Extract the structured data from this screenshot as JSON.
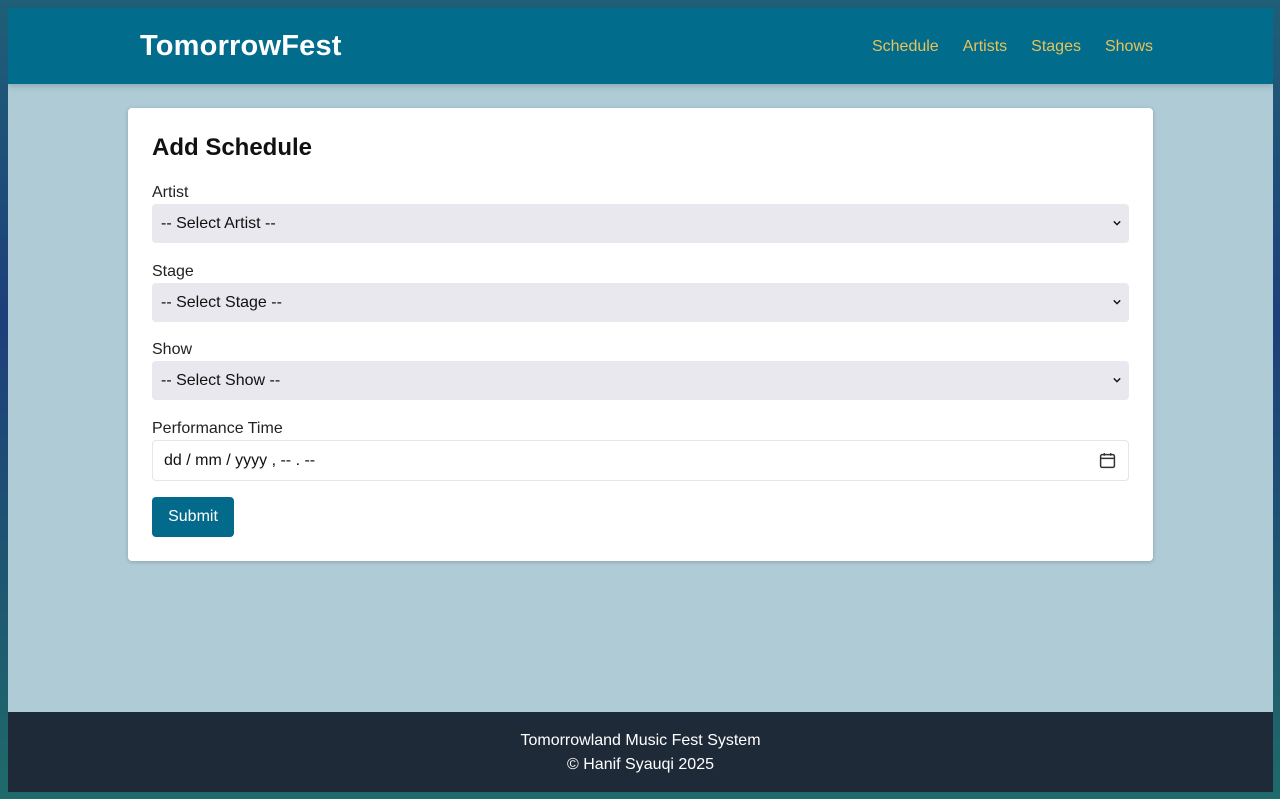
{
  "navbar": {
    "brand": "TomorrowFest",
    "links": [
      "Schedule",
      "Artists",
      "Stages",
      "Shows"
    ]
  },
  "form": {
    "title": "Add Schedule",
    "artist": {
      "label": "Artist",
      "value": "-- Select Artist --"
    },
    "stage": {
      "label": "Stage",
      "value": "-- Select Stage --"
    },
    "show": {
      "label": "Show",
      "value": "-- Select Show --"
    },
    "performance_time": {
      "label": "Performance Time",
      "placeholder": "dd / mm / yyyy ,  -- . --"
    },
    "submit_label": "Submit"
  },
  "footer": {
    "line1": "Tomorrowland Music Fest System",
    "line2": "© Hanif Syauqi 2025"
  },
  "colors": {
    "navbar": "#026c8d",
    "nav_link": "#e7c35a",
    "page_bg": "#aecbd6",
    "footer_bg": "#1f2a38",
    "button": "#036a8b"
  },
  "icons": {
    "select_arrow": "chevron-down-icon",
    "date_picker": "calendar-icon"
  }
}
